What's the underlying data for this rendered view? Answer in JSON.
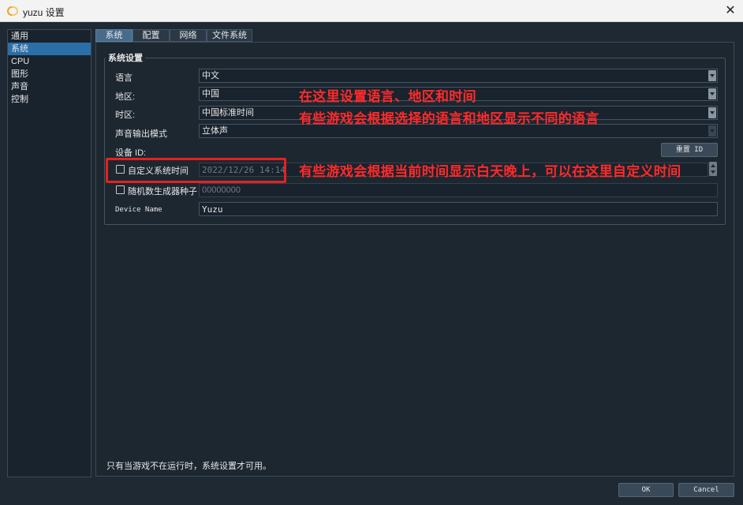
{
  "window": {
    "title": "yuzu 设置",
    "close_glyph": "✕"
  },
  "sidebar": {
    "items": [
      {
        "label": "通用",
        "selected": false
      },
      {
        "label": "系统",
        "selected": true
      },
      {
        "label": "CPU",
        "selected": false
      },
      {
        "label": "图形",
        "selected": false
      },
      {
        "label": "声音",
        "selected": false
      },
      {
        "label": "控制",
        "selected": false
      }
    ]
  },
  "tabs": [
    {
      "label": "系统",
      "active": true
    },
    {
      "label": "配置",
      "active": false
    },
    {
      "label": "网络",
      "active": false
    },
    {
      "label": "文件系统",
      "active": false
    }
  ],
  "group": {
    "title": "系统设置",
    "language": {
      "label": "语言",
      "value": "中文"
    },
    "region": {
      "label": "地区:",
      "value": "中国"
    },
    "timezone": {
      "label": "时区:",
      "value": "中国标准时间"
    },
    "sound_mode": {
      "label": "声音输出模式",
      "value": "立体声"
    },
    "device_id": {
      "label": "设备 ID:",
      "button": "重置 ID"
    },
    "custom_time": {
      "label": "自定义系统时间",
      "checked": false,
      "value": "2022/12/26 14:14"
    },
    "rng_seed": {
      "label": "随机数生成器种子",
      "checked": false,
      "value": "00000000"
    },
    "device_name": {
      "label": "Device Name",
      "value": "Yuzu"
    }
  },
  "annotations": {
    "line1": "在这里设置语言、地区和时间",
    "line2": "有些游戏会根据选择的语言和地区显示不同的语言",
    "line3": "有些游戏会根据当前时间显示白天晚上，可以在这里自定义时间",
    "color": "#ff2a2a"
  },
  "footer": {
    "note": "只有当游戏不在运行时，系统设置才可用。",
    "ok": "OK",
    "cancel": "Cancel"
  },
  "colors": {
    "background": "#1f2933",
    "selected": "#2a6fa8",
    "tab_active": "#466b8c",
    "annotation": "#e62020"
  }
}
